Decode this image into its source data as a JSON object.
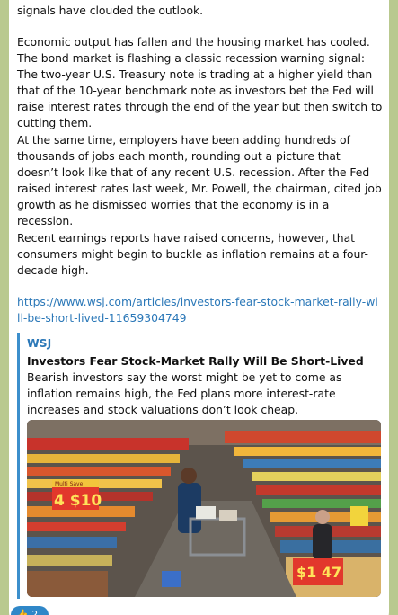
{
  "message": {
    "paragraphs": [
      "signals have clouded the outlook.",
      "Economic output has fallen and the housing market has cooled. The bond market is flashing a classic recession warning signal: The two-year U.S. Treasury note is trading at a higher yield than that of the 10-year benchmark note as investors bet the Fed will raise interest rates through the end of the year but then switch to cutting them.",
      "At the same time, employers have been adding hundreds of thousands of jobs each month, rounding out a picture that doesn’t look like that of any recent U.S. recession. After the Fed raised interest rates last week, Mr. Powell, the chairman, cited job growth as he dismissed worries that the economy is in a recession.",
      "Recent earnings reports have raised concerns, however, that consumers might begin to buckle as inflation remains at a four-decade high."
    ],
    "link": "https://www.wsj.com/articles/investors-fear-stock-market-rally-will-be-short-lived-11659304749"
  },
  "preview": {
    "site": "WSJ",
    "title": "Investors Fear Stock-Market Rally Will Be Short-Lived",
    "description": "Bearish investors say the worst might be yet to come as inflation remains high, the Fed plans more interest-rate increases and stock valuations don’t look cheap.",
    "image_signs": {
      "multi_save_label": "Multi Save",
      "price_left": "4 $10",
      "price_right": "$1 47"
    }
  },
  "reaction": {
    "emoji": "👍",
    "count": "2"
  }
}
